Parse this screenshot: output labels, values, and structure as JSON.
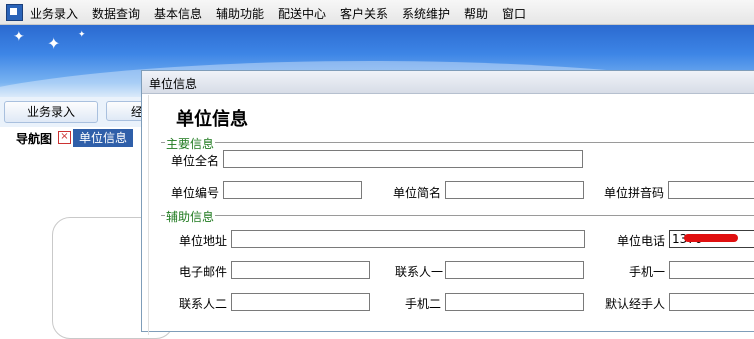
{
  "menubar": {
    "items": [
      "业务录入",
      "数据查询",
      "基本信息",
      "辅助功能",
      "配送中心",
      "客户关系",
      "系统维护",
      "帮助",
      "窗口"
    ]
  },
  "toolbar": {
    "buttons": [
      "业务录入",
      "经"
    ]
  },
  "tabs": {
    "nav_label": "导航图",
    "active_label": "单位信息"
  },
  "dialog": {
    "window_title": "单位信息",
    "heading": "单位信息",
    "main_group": {
      "title": "主要信息",
      "fields": [
        {
          "label": "单位全名",
          "value": ""
        },
        {
          "label": "单位编号",
          "value": ""
        },
        {
          "label": "单位简名",
          "value": ""
        },
        {
          "label": "单位拼音码",
          "value": ""
        }
      ]
    },
    "aux_group": {
      "title": "辅助信息",
      "fields": [
        {
          "label": "单位地址",
          "value": ""
        },
        {
          "label": "单位电话",
          "value": "1370"
        },
        {
          "label": "电子邮件",
          "value": ""
        },
        {
          "label": "联系人一",
          "value": ""
        },
        {
          "label": "手机一",
          "value": ""
        },
        {
          "label": "联系人二",
          "value": ""
        },
        {
          "label": "手机二",
          "value": ""
        },
        {
          "label": "默认经手人",
          "value": ""
        }
      ]
    }
  },
  "colors": {
    "banner_blue": "#3d85e6",
    "active_tab": "#2f5fa9",
    "group_title_green": "#1f7a1f"
  }
}
